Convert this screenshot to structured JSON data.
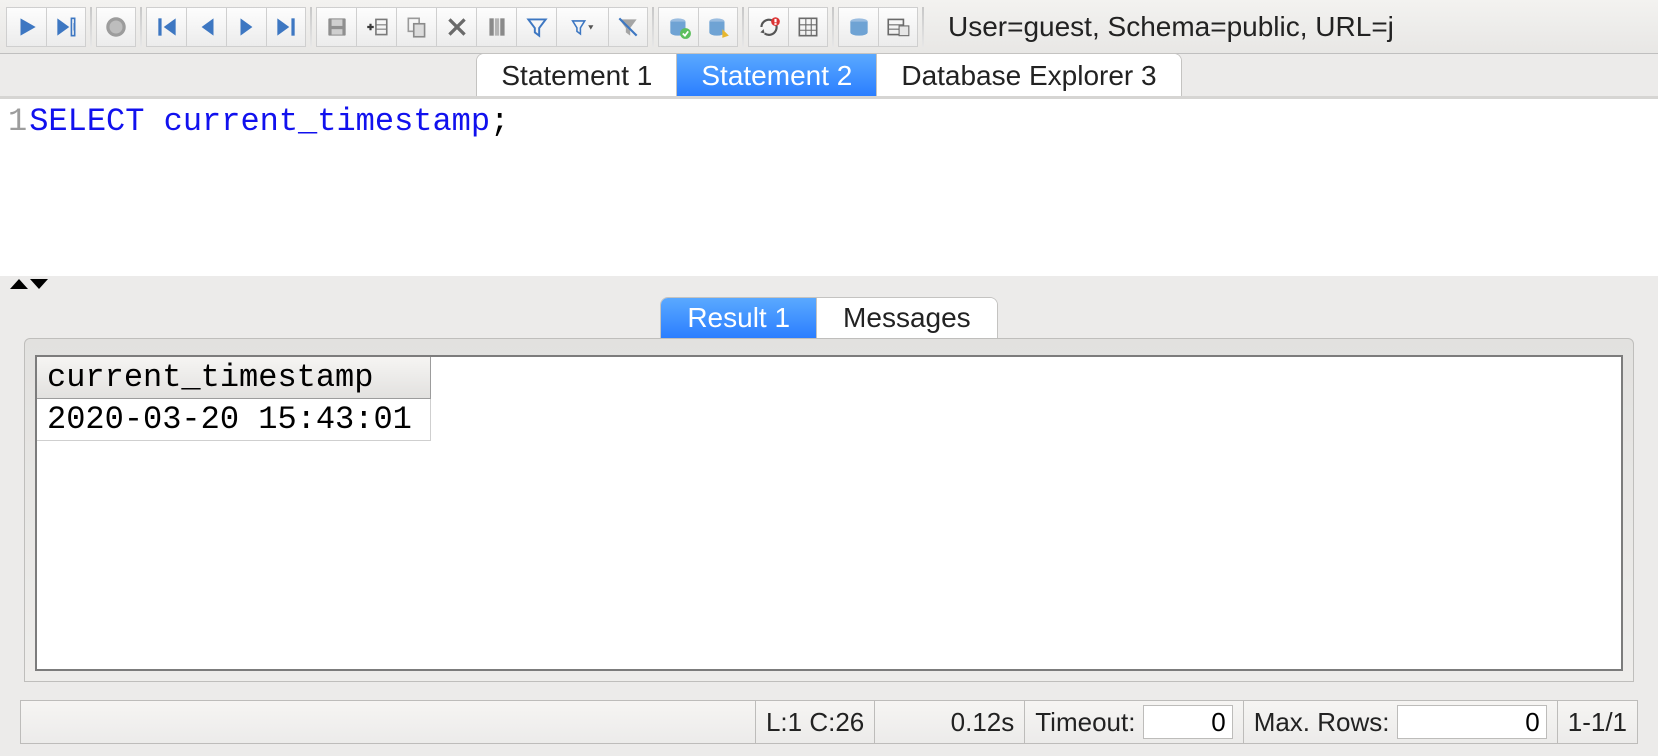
{
  "toolbar": {
    "status_text": "User=guest, Schema=public, URL=j",
    "buttons": {
      "run": "run-icon",
      "run_cursor": "run-to-cursor-icon",
      "stop": "stop-icon",
      "first": "first-record-icon",
      "prev": "prev-record-icon",
      "next": "next-record-icon",
      "last": "last-record-icon",
      "save": "save-icon",
      "insert_row": "insert-row-icon",
      "duplicate_row": "duplicate-row-icon",
      "delete_row": "delete-row-icon",
      "columns": "columns-icon",
      "filter": "filter-icon",
      "filter_dropdown": "filter-dropdown-icon",
      "clear_filter": "clear-filter-icon",
      "commit": "commit-icon",
      "rollback": "rollback-icon",
      "refresh": "refresh-icon",
      "grid_options": "grid-options-icon",
      "db_browser": "db-browser-icon",
      "table_view": "table-view-icon"
    }
  },
  "tabs": [
    {
      "label": "Statement 1",
      "active": false
    },
    {
      "label": "Statement 2",
      "active": true
    },
    {
      "label": "Database Explorer 3",
      "active": false
    }
  ],
  "editor": {
    "line_number": "1",
    "sql_keyword": "SELECT",
    "sql_rest": " current_timestamp",
    "sql_punct": ";"
  },
  "result_tabs": [
    {
      "label": "Result 1",
      "active": true
    },
    {
      "label": "Messages",
      "active": false
    }
  ],
  "result_grid": {
    "columns": [
      "current_timestamp"
    ],
    "rows": [
      [
        "2020-03-20 15:43:01"
      ]
    ]
  },
  "statusbar": {
    "cursor": "L:1 C:26",
    "elapsed": "0.12s",
    "timeout_label": "Timeout:",
    "timeout_value": "0",
    "max_rows_label": "Max. Rows:",
    "max_rows_value": "0",
    "rows_range": "1-1/1"
  }
}
